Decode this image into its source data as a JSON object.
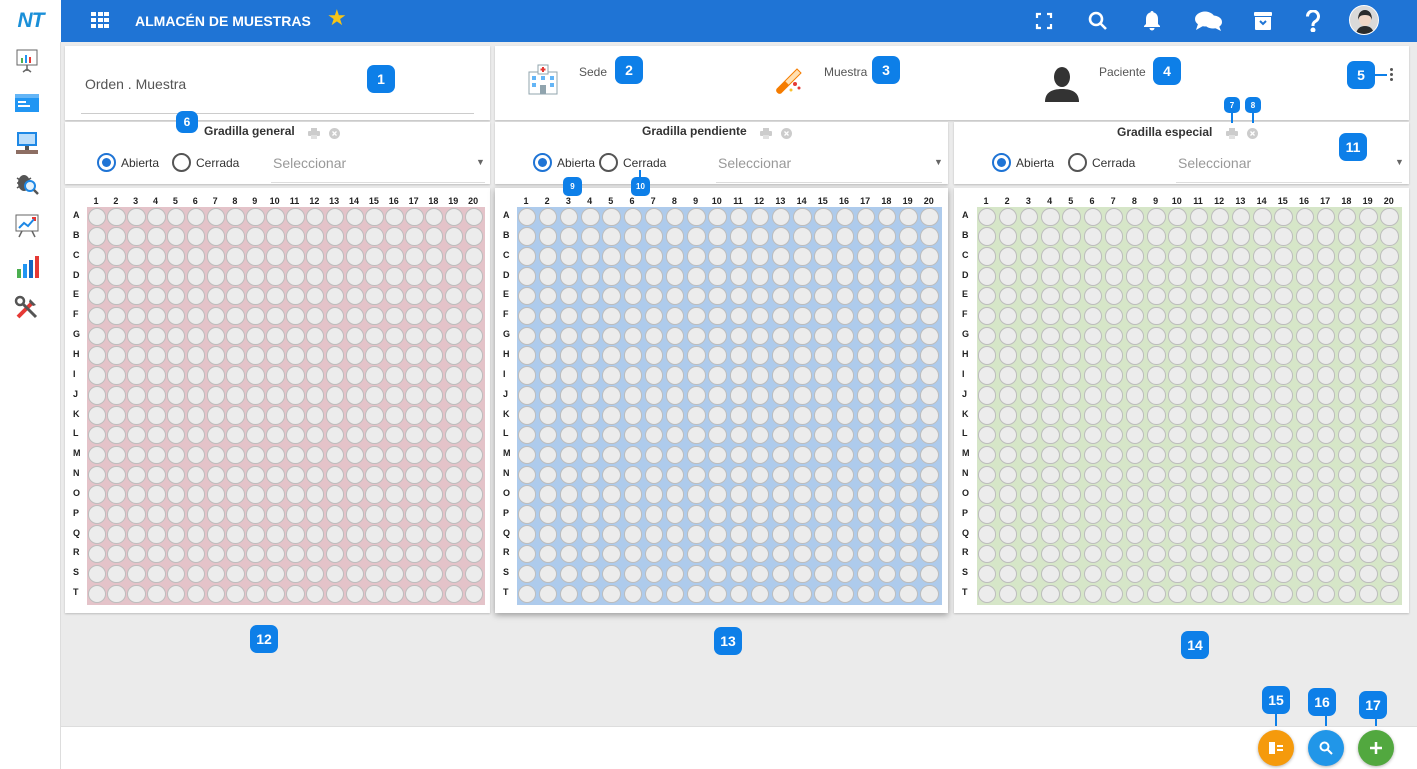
{
  "header": {
    "logo": "NT",
    "title": "ALMACÉN DE MUESTRAS",
    "icons": [
      "apps-icon",
      "star-icon",
      "fullscreen-icon",
      "search-icon",
      "bell-icon",
      "chat-icon",
      "archive-icon",
      "help-icon",
      "avatar"
    ]
  },
  "sidebar": {
    "icons": [
      "presentation-chart-icon",
      "folder-window-icon",
      "monitor-desk-icon",
      "bug-search-icon",
      "trend-board-icon",
      "bar-chart-icon",
      "tools-icon"
    ]
  },
  "order": {
    "placeholder": "Orden . Muestra"
  },
  "info": {
    "sede": "Sede",
    "muestra": "Muestra",
    "paciente": "Paciente"
  },
  "racks": [
    {
      "title": "Gradilla general",
      "open_label": "Abierta",
      "closed_label": "Cerrada",
      "select_placeholder": "Seleccionar",
      "selected": "Abierta",
      "color": "#e4c3c9"
    },
    {
      "title": "Gradilla pendiente",
      "open_label": "Abierta",
      "closed_label": "Cerrada",
      "select_placeholder": "Seleccionar",
      "selected": "Abierta",
      "color": "#aecbec"
    },
    {
      "title": "Gradilla especial",
      "open_label": "Abierta",
      "closed_label": "Cerrada",
      "select_placeholder": "Seleccionar",
      "selected": "Abierta",
      "color": "#d6e6c8"
    }
  ],
  "grid": {
    "columns": [
      "1",
      "2",
      "3",
      "4",
      "5",
      "6",
      "7",
      "8",
      "9",
      "10",
      "11",
      "12",
      "13",
      "14",
      "15",
      "16",
      "17",
      "18",
      "19",
      "20"
    ],
    "rows": [
      "A",
      "B",
      "C",
      "D",
      "E",
      "F",
      "G",
      "H",
      "I",
      "J",
      "K",
      "L",
      "M",
      "N",
      "O",
      "P",
      "Q",
      "R",
      "S",
      "T"
    ]
  },
  "badges": [
    "1",
    "2",
    "3",
    "4",
    "5",
    "6",
    "7",
    "8",
    "9",
    "10",
    "11",
    "12",
    "13",
    "14",
    "15",
    "16",
    "17"
  ],
  "fab": {
    "colors": [
      "#f59a0c",
      "#2196e8",
      "#52a83f"
    ]
  },
  "colors": {
    "primary": "#1f74d5",
    "badge": "#0d7fe8"
  }
}
